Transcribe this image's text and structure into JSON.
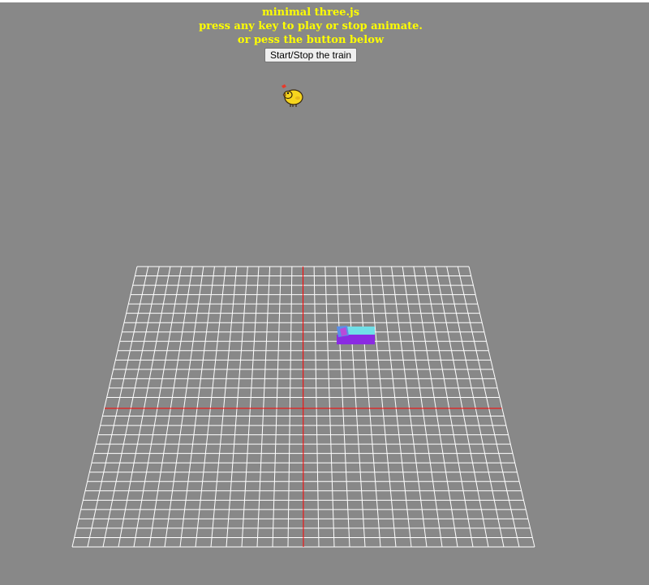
{
  "info": {
    "title": "minimal three.js",
    "line2": "press any key to play or stop animate.",
    "line3": "or pess the button below"
  },
  "controls": {
    "start_stop_label": "Start/Stop the train"
  },
  "colors": {
    "background": "#888888",
    "info_text": "#ffff00",
    "grid": "#ffffff",
    "grid_axis": "#ff0000",
    "train_top": "#70e0e8",
    "train_bottom": "#8a2be2"
  },
  "scene": {
    "grid_divisions": 30,
    "icons": [
      "chick-icon"
    ]
  }
}
